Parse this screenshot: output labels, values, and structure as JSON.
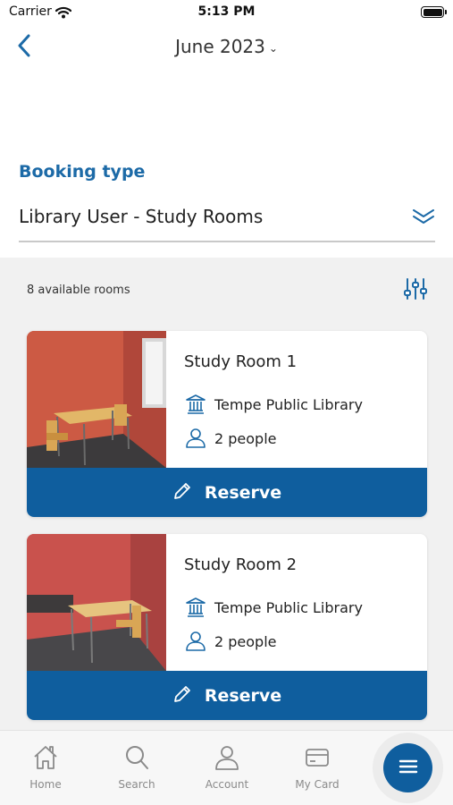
{
  "status_bar": {
    "carrier": "Carrier",
    "time": "5:13 PM"
  },
  "header": {
    "month": "June 2023"
  },
  "booking": {
    "label": "Booking type",
    "selected": "Library User - Study Rooms"
  },
  "rooms_list": {
    "count_text": "8 available rooms",
    "rooms": [
      {
        "name": "Study Room 1",
        "location": "Tempe Public Library",
        "capacity": "2 people",
        "action": "Reserve"
      },
      {
        "name": "Study Room 2",
        "location": "Tempe Public Library",
        "capacity": "2 people",
        "action": "Reserve"
      }
    ]
  },
  "tab_bar": {
    "items": [
      {
        "label": "Home",
        "icon": "home-icon"
      },
      {
        "label": "Search",
        "icon": "search-icon"
      },
      {
        "label": "Account",
        "icon": "person-icon"
      },
      {
        "label": "My Card",
        "icon": "card-icon"
      }
    ],
    "menu_icon": "menu-icon"
  },
  "colors": {
    "accent": "#1c6aa7",
    "button": "#0f5e9e",
    "list_background": "#f1f1f1"
  }
}
